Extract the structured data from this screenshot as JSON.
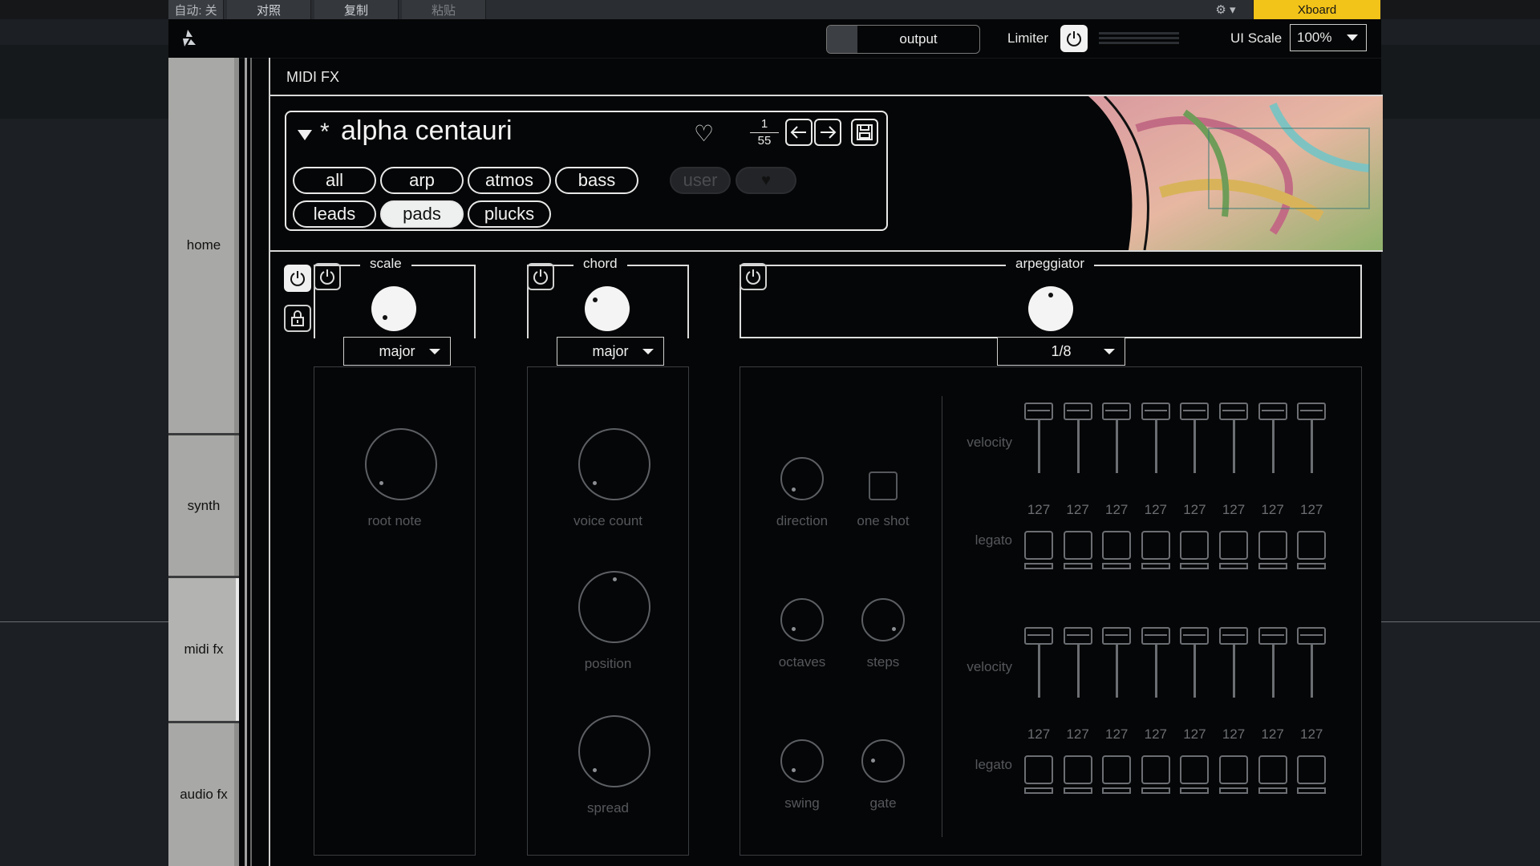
{
  "host": {
    "auto_label": "自动: 关",
    "compare_label": "对照",
    "copy_label": "复制",
    "paste_label": "粘贴",
    "xboard_label": "Xboard"
  },
  "topbar": {
    "output_label": "output",
    "limiter_label": "Limiter",
    "uiscale_label": "UI Scale",
    "uiscale_value": "100%"
  },
  "sidebar": {
    "items": [
      {
        "label": "home"
      },
      {
        "label": "synth"
      },
      {
        "label": "midi fx"
      },
      {
        "label": "audio fx"
      }
    ]
  },
  "main": {
    "title": "MIDI FX"
  },
  "preset": {
    "modified_marker": "*",
    "name": "alpha centauri",
    "index": "1",
    "total": "55",
    "categories": [
      "all",
      "arp",
      "atmos",
      "bass",
      "leads",
      "pads",
      "plucks"
    ],
    "active_category": "pads",
    "user_label": "user"
  },
  "scale": {
    "title": "scale",
    "mode": "major",
    "root_label": "root note"
  },
  "chord": {
    "title": "chord",
    "mode": "major",
    "voice_count_label": "voice count",
    "position_label": "position",
    "spread_label": "spread"
  },
  "arpeggiator": {
    "title": "arpeggiator",
    "rate": "1/8",
    "direction_label": "direction",
    "oneshot_label": "one shot",
    "octaves_label": "octaves",
    "steps_label": "steps",
    "swing_label": "swing",
    "gate_label": "gate",
    "velocity_label": "velocity",
    "legato_label": "legato",
    "row1_velocities": [
      "127",
      "127",
      "127",
      "127",
      "127",
      "127",
      "127",
      "127"
    ],
    "row2_velocities": [
      "127",
      "127",
      "127",
      "127",
      "127",
      "127",
      "127",
      "127"
    ]
  },
  "colors": {
    "accent": "#f2c318",
    "panel_bg": "#050607",
    "sidebar_tab": "#a8a8a6",
    "disabled": "#55585c"
  }
}
